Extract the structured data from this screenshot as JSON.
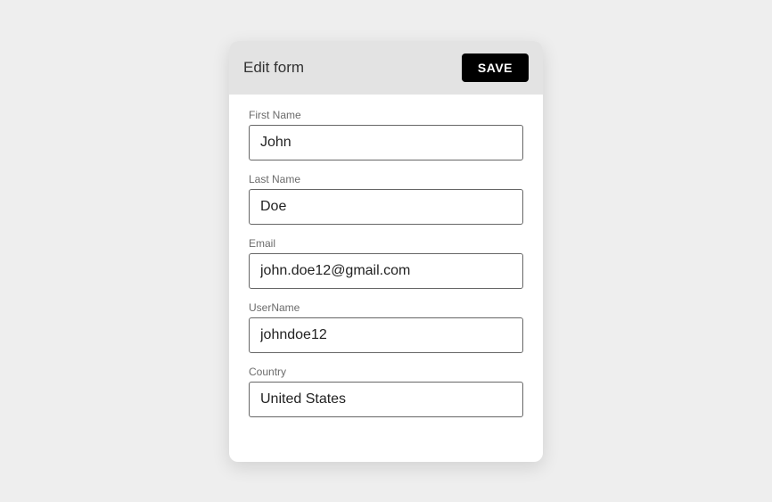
{
  "header": {
    "title": "Edit form",
    "save_label": "SAVE"
  },
  "fields": {
    "first_name": {
      "label": "First Name",
      "value": "John"
    },
    "last_name": {
      "label": "Last Name",
      "value": "Doe"
    },
    "email": {
      "label": "Email",
      "value": "john.doe12@gmail.com"
    },
    "username": {
      "label": "UserName",
      "value": "johndoe12"
    },
    "country": {
      "label": "Country",
      "value": "United States"
    }
  }
}
